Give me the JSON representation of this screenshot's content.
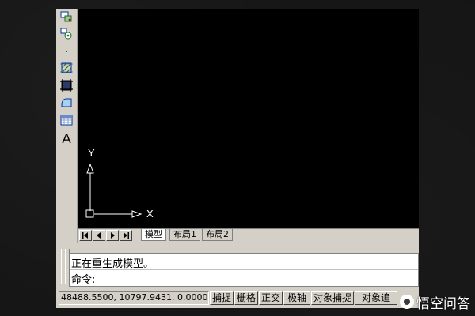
{
  "toolbar": {
    "items": [
      "insert-block-icon",
      "make-block-icon",
      "point-icon",
      "hatch-icon",
      "gradient-icon",
      "region-icon",
      "table-icon",
      "multiline-text-icon"
    ],
    "text_tool_label": "A"
  },
  "canvas": {
    "background": "#000000",
    "ucs_x_label": "X",
    "ucs_y_label": "Y"
  },
  "tabs": {
    "nav": [
      "first-tab",
      "prev-tab",
      "next-tab",
      "last-tab"
    ],
    "items": [
      {
        "label": "模型",
        "active": true
      },
      {
        "label": "布局1",
        "active": false
      },
      {
        "label": "布局2",
        "active": false
      }
    ]
  },
  "command": {
    "history_line": "正在重生成模型。",
    "prompt_line": "命令:"
  },
  "status": {
    "coordinates": "48488.5500, 10797.9431, 0.0000",
    "snap": "捕捉",
    "grid": "栅格",
    "ortho": "正交",
    "polar": "极轴",
    "osnap": "对象捕捉",
    "otrack": "对象追"
  },
  "watermark": {
    "text": "悟空问答"
  }
}
